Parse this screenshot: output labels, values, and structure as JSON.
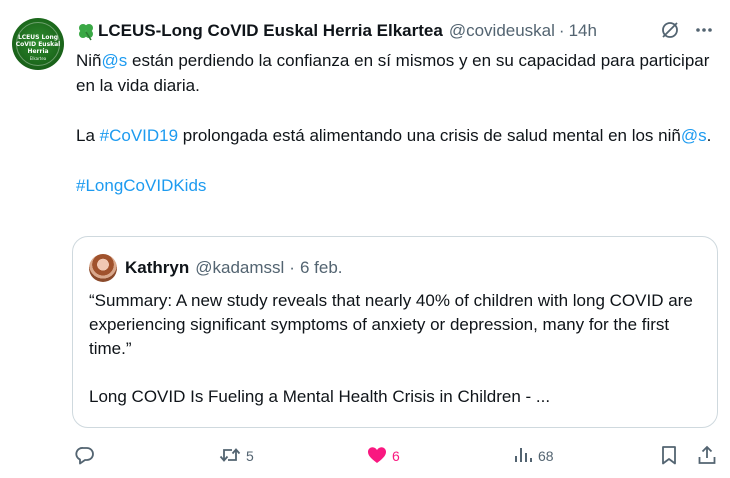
{
  "tweet": {
    "author_name": "LCEUS-Long CoVID Euskal Herria Elkartea",
    "author_handle": "@covideuskal",
    "separator": "·",
    "time": "14h",
    "avatar_text_top": "LCEUS Long CoVID Euskal Herria",
    "avatar_text_bottom": "Elkartea",
    "text": {
      "p1_a": "Niñ",
      "p1_link": "@s",
      "p1_b": " están perdiendo la confianza en sí mismos y en su capacidad para participar en la vida diaria.",
      "p2_a": "La ",
      "p2_link": "#CoVID19",
      "p2_b": " prolongada está alimentando una crisis de salud mental en los niñ",
      "p2_link2": "@s",
      "p2_c": ".",
      "p3_link": "#LongCoVIDKids"
    }
  },
  "quote": {
    "author_name": "Kathryn",
    "author_handle": "@kadamssl",
    "separator": "·",
    "date": "6 feb.",
    "text_p1": "“Summary: A new study reveals that nearly 40% of children with long COVID are experiencing significant symptoms of anxiety or depression, many for the first time.”",
    "text_p2": "Long COVID Is Fueling a Mental Health Crisis in Children - ..."
  },
  "actions": {
    "reply_count": "",
    "retweet_count": "5",
    "like_count": "6",
    "views_count": "68"
  },
  "icons": {
    "clover": "four-leaf-clover-icon",
    "grok": "grok-icon",
    "more": "more-icon",
    "reply": "reply-icon",
    "retweet": "retweet-icon",
    "like": "heart-icon",
    "views": "views-icon",
    "bookmark": "bookmark-icon",
    "share": "share-icon"
  },
  "colors": {
    "link": "#1d9bf0",
    "muted": "#536471",
    "liked": "#f91880",
    "border": "#cfd9de",
    "clover": "#3aa845"
  }
}
